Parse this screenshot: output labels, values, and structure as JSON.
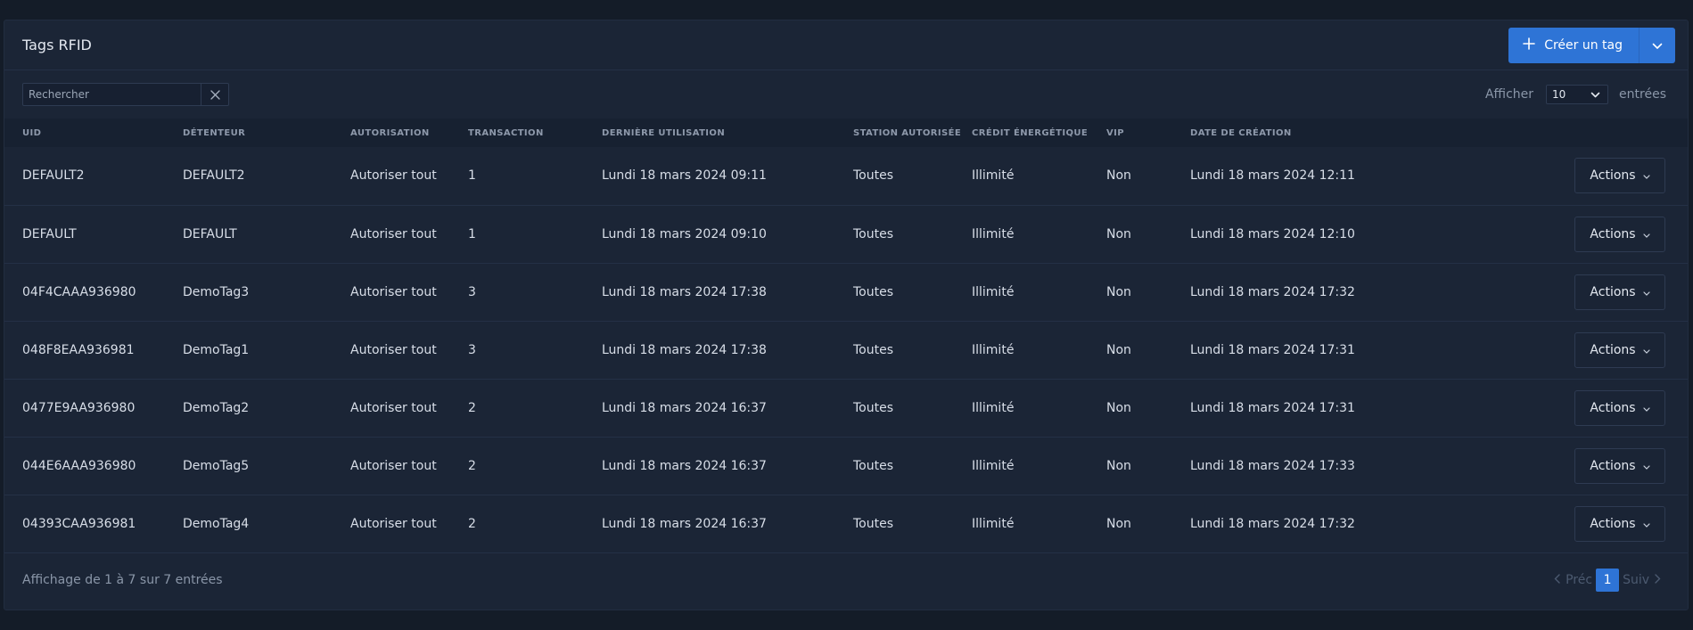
{
  "card": {
    "title": "Tags RFID"
  },
  "create_button": {
    "label": "Créer un tag",
    "icon": "plus-icon",
    "caret_icon": "chevron-down-icon"
  },
  "search": {
    "placeholder": "Rechercher",
    "value": "",
    "clear_icon": "close-icon"
  },
  "page_size": {
    "before": "Afficher",
    "value": "10",
    "after": "entrées"
  },
  "table": {
    "headers": [
      "UID",
      "Détenteur",
      "Autorisation",
      "Transaction",
      "Dernière utilisation",
      "Station autorisée",
      "Crédit énergétique",
      "VIP",
      "Date de création",
      ""
    ],
    "rows": [
      {
        "uid": "DEFAULT2",
        "holder": "DEFAULT2",
        "authorization": "Autoriser tout",
        "transaction": "1",
        "last_used": "Lundi 18 mars 2024 09:11",
        "station": "Toutes",
        "credit": "Illimité",
        "vip": "Non",
        "created": "Lundi 18 mars 2024 12:11",
        "actions": "Actions"
      },
      {
        "uid": "DEFAULT",
        "holder": "DEFAULT",
        "authorization": "Autoriser tout",
        "transaction": "1",
        "last_used": "Lundi 18 mars 2024 09:10",
        "station": "Toutes",
        "credit": "Illimité",
        "vip": "Non",
        "created": "Lundi 18 mars 2024 12:10",
        "actions": "Actions"
      },
      {
        "uid": "04F4CAAA936980",
        "holder": "DemoTag3",
        "authorization": "Autoriser tout",
        "transaction": "3",
        "last_used": "Lundi 18 mars 2024 17:38",
        "station": "Toutes",
        "credit": "Illimité",
        "vip": "Non",
        "created": "Lundi 18 mars 2024 17:32",
        "actions": "Actions"
      },
      {
        "uid": "048F8EAA936981",
        "holder": "DemoTag1",
        "authorization": "Autoriser tout",
        "transaction": "3",
        "last_used": "Lundi 18 mars 2024 17:38",
        "station": "Toutes",
        "credit": "Illimité",
        "vip": "Non",
        "created": "Lundi 18 mars 2024 17:31",
        "actions": "Actions"
      },
      {
        "uid": "0477E9AA936980",
        "holder": "DemoTag2",
        "authorization": "Autoriser tout",
        "transaction": "2",
        "last_used": "Lundi 18 mars 2024 16:37",
        "station": "Toutes",
        "credit": "Illimité",
        "vip": "Non",
        "created": "Lundi 18 mars 2024 17:31",
        "actions": "Actions"
      },
      {
        "uid": "044E6AAA936980",
        "holder": "DemoTag5",
        "authorization": "Autoriser tout",
        "transaction": "2",
        "last_used": "Lundi 18 mars 2024 16:37",
        "station": "Toutes",
        "credit": "Illimité",
        "vip": "Non",
        "created": "Lundi 18 mars 2024 17:33",
        "actions": "Actions"
      },
      {
        "uid": "04393CAA936981",
        "holder": "DemoTag4",
        "authorization": "Autoriser tout",
        "transaction": "2",
        "last_used": "Lundi 18 mars 2024 16:37",
        "station": "Toutes",
        "credit": "Illimité",
        "vip": "Non",
        "created": "Lundi 18 mars 2024 17:32",
        "actions": "Actions"
      }
    ]
  },
  "footer": {
    "info": "Affichage de 1 à 7 sur 7 entrées",
    "prev_label": "Préc",
    "next_label": "Suiv",
    "current_page": "1"
  },
  "colors": {
    "accent": "#2e74d6",
    "background": "#141c28",
    "card": "#1b2536"
  }
}
